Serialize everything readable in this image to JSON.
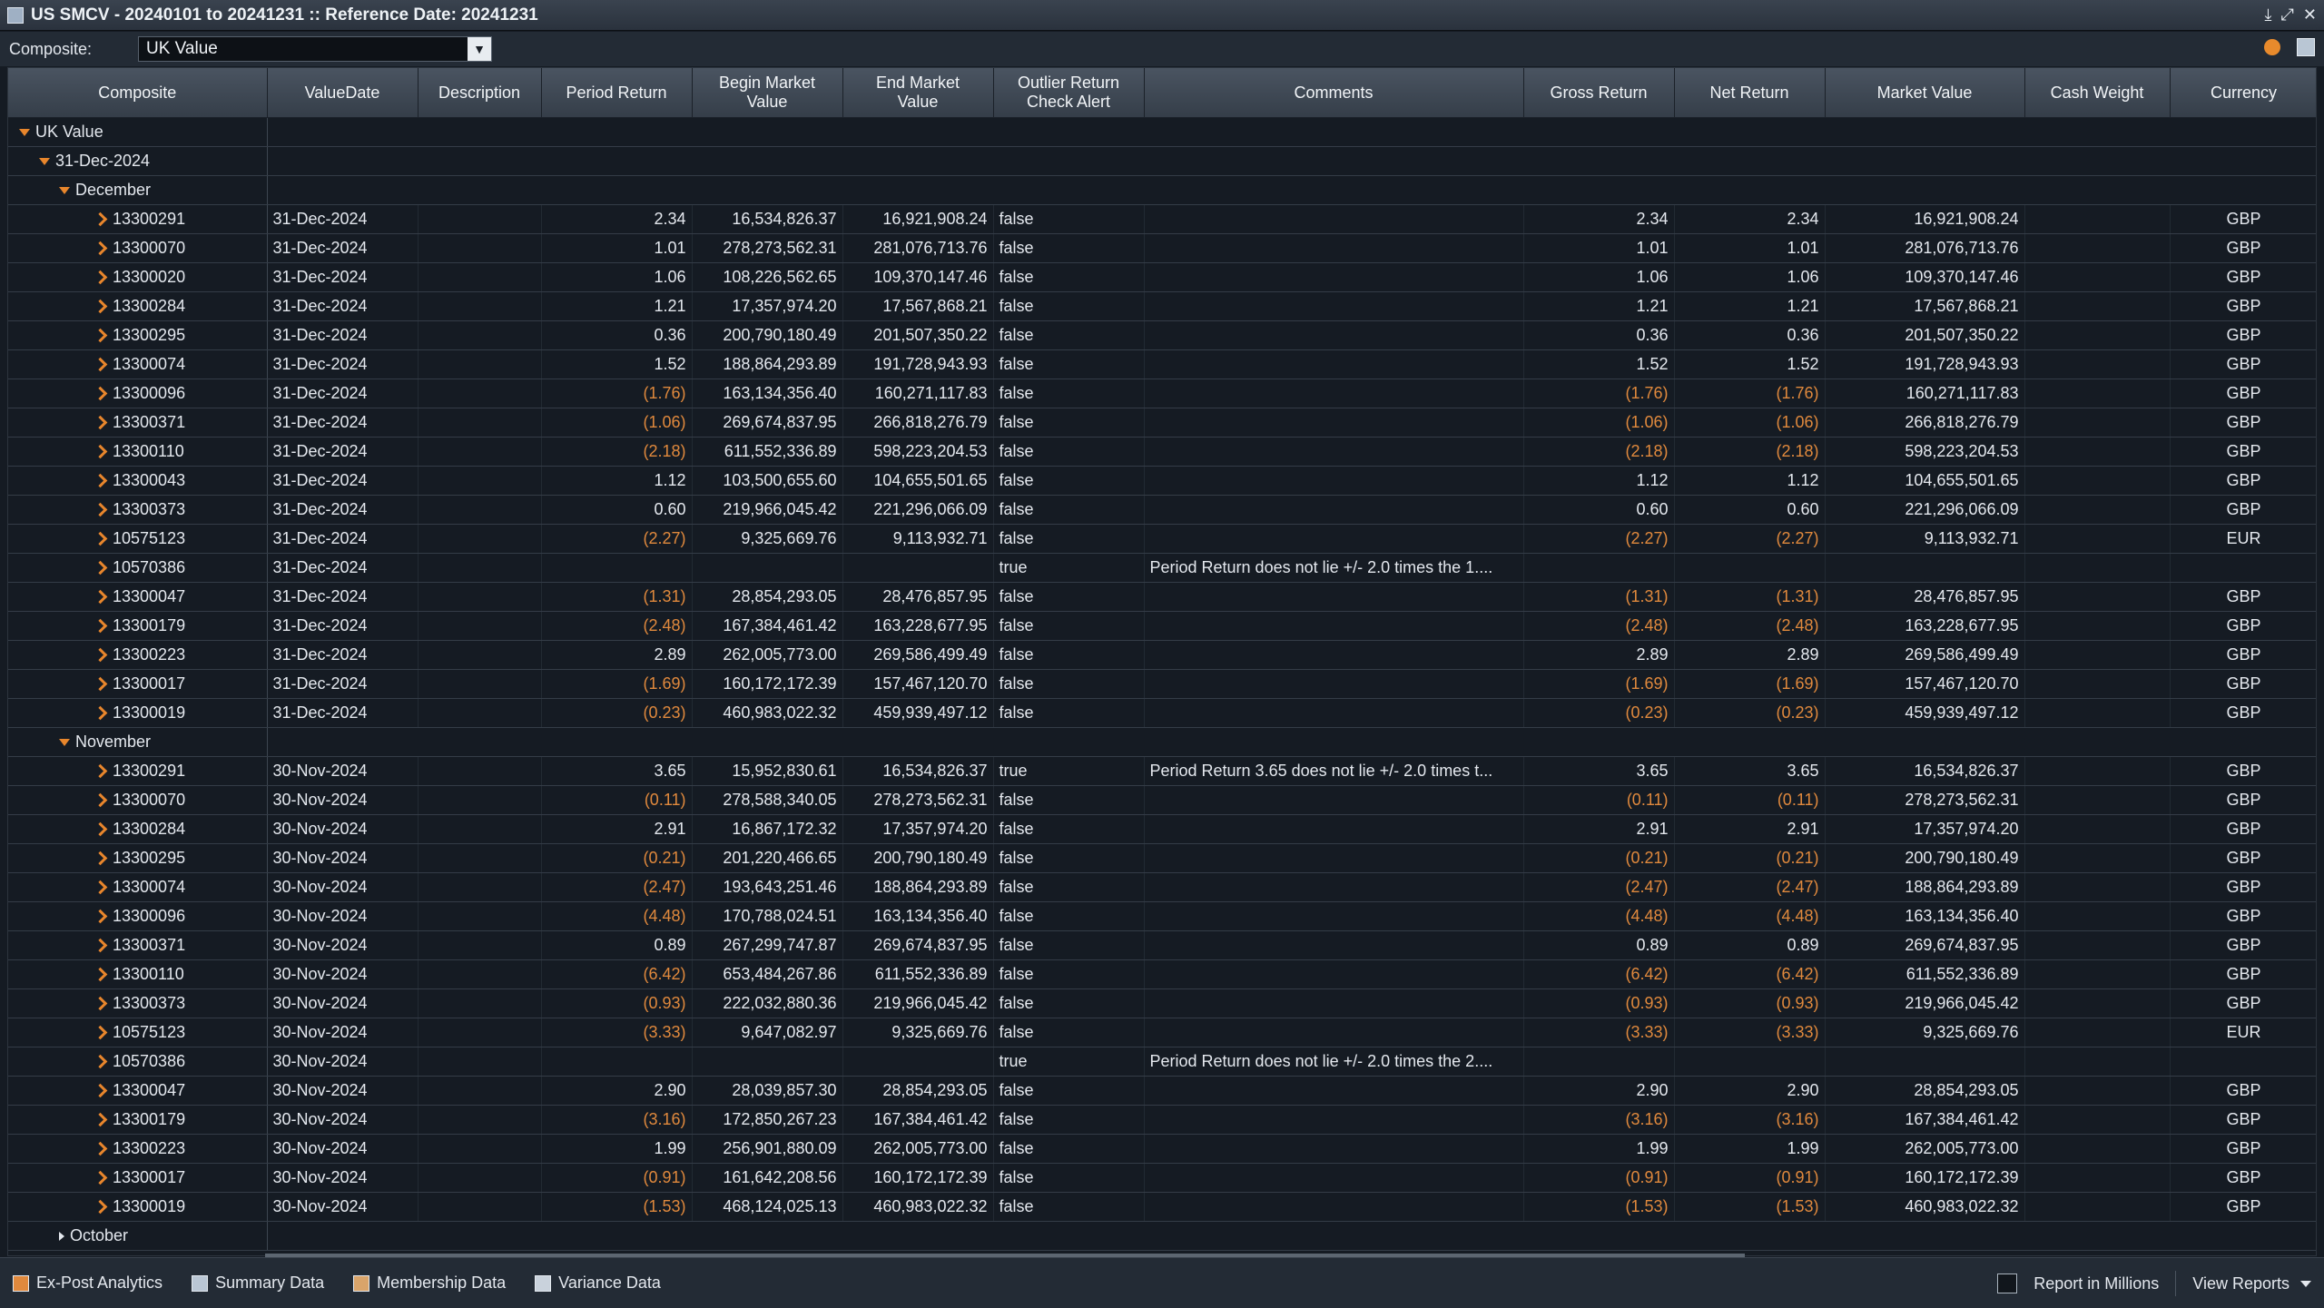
{
  "window": {
    "title": "US SMCV - 20240101 to 20241231 :: Reference Date: 20241231"
  },
  "toolbar": {
    "composite_label": "Composite:",
    "composite_value": "UK Value"
  },
  "columns": [
    "Composite",
    "ValueDate",
    "Description",
    "Period Return",
    "Begin Market\nValue",
    "End Market\nValue",
    "Outlier Return\nCheck Alert",
    "Comments",
    "Gross Return",
    "Net Return",
    "Market Value",
    "Cash Weight",
    "Currency"
  ],
  "tree": {
    "root": "UK Value",
    "date": "31-Dec-2024",
    "groups": [
      {
        "label": "December",
        "expanded": true,
        "rows": [
          {
            "id": "13300291",
            "date": "31-Dec-2024",
            "pr": "2.34",
            "bmv": "16,534,826.37",
            "emv": "16,921,908.24",
            "alert": "false",
            "comment": "",
            "gr": "2.34",
            "nr": "2.34",
            "mv": "16,921,908.24",
            "cur": "GBP"
          },
          {
            "id": "13300070",
            "date": "31-Dec-2024",
            "pr": "1.01",
            "bmv": "278,273,562.31",
            "emv": "281,076,713.76",
            "alert": "false",
            "comment": "",
            "gr": "1.01",
            "nr": "1.01",
            "mv": "281,076,713.76",
            "cur": "GBP"
          },
          {
            "id": "13300020",
            "date": "31-Dec-2024",
            "pr": "1.06",
            "bmv": "108,226,562.65",
            "emv": "109,370,147.46",
            "alert": "false",
            "comment": "",
            "gr": "1.06",
            "nr": "1.06",
            "mv": "109,370,147.46",
            "cur": "GBP"
          },
          {
            "id": "13300284",
            "date": "31-Dec-2024",
            "pr": "1.21",
            "bmv": "17,357,974.20",
            "emv": "17,567,868.21",
            "alert": "false",
            "comment": "",
            "gr": "1.21",
            "nr": "1.21",
            "mv": "17,567,868.21",
            "cur": "GBP"
          },
          {
            "id": "13300295",
            "date": "31-Dec-2024",
            "pr": "0.36",
            "bmv": "200,790,180.49",
            "emv": "201,507,350.22",
            "alert": "false",
            "comment": "",
            "gr": "0.36",
            "nr": "0.36",
            "mv": "201,507,350.22",
            "cur": "GBP"
          },
          {
            "id": "13300074",
            "date": "31-Dec-2024",
            "pr": "1.52",
            "bmv": "188,864,293.89",
            "emv": "191,728,943.93",
            "alert": "false",
            "comment": "",
            "gr": "1.52",
            "nr": "1.52",
            "mv": "191,728,943.93",
            "cur": "GBP"
          },
          {
            "id": "13300096",
            "date": "31-Dec-2024",
            "pr": "(1.76)",
            "bmv": "163,134,356.40",
            "emv": "160,271,117.83",
            "alert": "false",
            "comment": "",
            "gr": "(1.76)",
            "nr": "(1.76)",
            "mv": "160,271,117.83",
            "cur": "GBP"
          },
          {
            "id": "13300371",
            "date": "31-Dec-2024",
            "pr": "(1.06)",
            "bmv": "269,674,837.95",
            "emv": "266,818,276.79",
            "alert": "false",
            "comment": "",
            "gr": "(1.06)",
            "nr": "(1.06)",
            "mv": "266,818,276.79",
            "cur": "GBP"
          },
          {
            "id": "13300110",
            "date": "31-Dec-2024",
            "pr": "(2.18)",
            "bmv": "611,552,336.89",
            "emv": "598,223,204.53",
            "alert": "false",
            "comment": "",
            "gr": "(2.18)",
            "nr": "(2.18)",
            "mv": "598,223,204.53",
            "cur": "GBP"
          },
          {
            "id": "13300043",
            "date": "31-Dec-2024",
            "pr": "1.12",
            "bmv": "103,500,655.60",
            "emv": "104,655,501.65",
            "alert": "false",
            "comment": "",
            "gr": "1.12",
            "nr": "1.12",
            "mv": "104,655,501.65",
            "cur": "GBP"
          },
          {
            "id": "13300373",
            "date": "31-Dec-2024",
            "pr": "0.60",
            "bmv": "219,966,045.42",
            "emv": "221,296,066.09",
            "alert": "false",
            "comment": "",
            "gr": "0.60",
            "nr": "0.60",
            "mv": "221,296,066.09",
            "cur": "GBP"
          },
          {
            "id": "10575123",
            "date": "31-Dec-2024",
            "pr": "(2.27)",
            "bmv": "9,325,669.76",
            "emv": "9,113,932.71",
            "alert": "false",
            "comment": "",
            "gr": "(2.27)",
            "nr": "(2.27)",
            "mv": "9,113,932.71",
            "cur": "EUR"
          },
          {
            "id": "10570386",
            "date": "31-Dec-2024",
            "pr": "",
            "bmv": "",
            "emv": "",
            "alert": "true",
            "comment": "Period Return does not lie +/- 2.0 times the 1....",
            "gr": "",
            "nr": "",
            "mv": "",
            "cur": ""
          },
          {
            "id": "13300047",
            "date": "31-Dec-2024",
            "pr": "(1.31)",
            "bmv": "28,854,293.05",
            "emv": "28,476,857.95",
            "alert": "false",
            "comment": "",
            "gr": "(1.31)",
            "nr": "(1.31)",
            "mv": "28,476,857.95",
            "cur": "GBP"
          },
          {
            "id": "13300179",
            "date": "31-Dec-2024",
            "pr": "(2.48)",
            "bmv": "167,384,461.42",
            "emv": "163,228,677.95",
            "alert": "false",
            "comment": "",
            "gr": "(2.48)",
            "nr": "(2.48)",
            "mv": "163,228,677.95",
            "cur": "GBP"
          },
          {
            "id": "13300223",
            "date": "31-Dec-2024",
            "pr": "2.89",
            "bmv": "262,005,773.00",
            "emv": "269,586,499.49",
            "alert": "false",
            "comment": "",
            "gr": "2.89",
            "nr": "2.89",
            "mv": "269,586,499.49",
            "cur": "GBP"
          },
          {
            "id": "13300017",
            "date": "31-Dec-2024",
            "pr": "(1.69)",
            "bmv": "160,172,172.39",
            "emv": "157,467,120.70",
            "alert": "false",
            "comment": "",
            "gr": "(1.69)",
            "nr": "(1.69)",
            "mv": "157,467,120.70",
            "cur": "GBP"
          },
          {
            "id": "13300019",
            "date": "31-Dec-2024",
            "pr": "(0.23)",
            "bmv": "460,983,022.32",
            "emv": "459,939,497.12",
            "alert": "false",
            "comment": "",
            "gr": "(0.23)",
            "nr": "(0.23)",
            "mv": "459,939,497.12",
            "cur": "GBP"
          }
        ]
      },
      {
        "label": "November",
        "expanded": true,
        "rows": [
          {
            "id": "13300291",
            "date": "30-Nov-2024",
            "pr": "3.65",
            "bmv": "15,952,830.61",
            "emv": "16,534,826.37",
            "alert": "true",
            "comment": "Period Return 3.65 does not lie +/- 2.0 times t...",
            "gr": "3.65",
            "nr": "3.65",
            "mv": "16,534,826.37",
            "cur": "GBP"
          },
          {
            "id": "13300070",
            "date": "30-Nov-2024",
            "pr": "(0.11)",
            "bmv": "278,588,340.05",
            "emv": "278,273,562.31",
            "alert": "false",
            "comment": "",
            "gr": "(0.11)",
            "nr": "(0.11)",
            "mv": "278,273,562.31",
            "cur": "GBP"
          },
          {
            "id": "13300284",
            "date": "30-Nov-2024",
            "pr": "2.91",
            "bmv": "16,867,172.32",
            "emv": "17,357,974.20",
            "alert": "false",
            "comment": "",
            "gr": "2.91",
            "nr": "2.91",
            "mv": "17,357,974.20",
            "cur": "GBP"
          },
          {
            "id": "13300295",
            "date": "30-Nov-2024",
            "pr": "(0.21)",
            "bmv": "201,220,466.65",
            "emv": "200,790,180.49",
            "alert": "false",
            "comment": "",
            "gr": "(0.21)",
            "nr": "(0.21)",
            "mv": "200,790,180.49",
            "cur": "GBP"
          },
          {
            "id": "13300074",
            "date": "30-Nov-2024",
            "pr": "(2.47)",
            "bmv": "193,643,251.46",
            "emv": "188,864,293.89",
            "alert": "false",
            "comment": "",
            "gr": "(2.47)",
            "nr": "(2.47)",
            "mv": "188,864,293.89",
            "cur": "GBP"
          },
          {
            "id": "13300096",
            "date": "30-Nov-2024",
            "pr": "(4.48)",
            "bmv": "170,788,024.51",
            "emv": "163,134,356.40",
            "alert": "false",
            "comment": "",
            "gr": "(4.48)",
            "nr": "(4.48)",
            "mv": "163,134,356.40",
            "cur": "GBP"
          },
          {
            "id": "13300371",
            "date": "30-Nov-2024",
            "pr": "0.89",
            "bmv": "267,299,747.87",
            "emv": "269,674,837.95",
            "alert": "false",
            "comment": "",
            "gr": "0.89",
            "nr": "0.89",
            "mv": "269,674,837.95",
            "cur": "GBP"
          },
          {
            "id": "13300110",
            "date": "30-Nov-2024",
            "pr": "(6.42)",
            "bmv": "653,484,267.86",
            "emv": "611,552,336.89",
            "alert": "false",
            "comment": "",
            "gr": "(6.42)",
            "nr": "(6.42)",
            "mv": "611,552,336.89",
            "cur": "GBP"
          },
          {
            "id": "13300373",
            "date": "30-Nov-2024",
            "pr": "(0.93)",
            "bmv": "222,032,880.36",
            "emv": "219,966,045.42",
            "alert": "false",
            "comment": "",
            "gr": "(0.93)",
            "nr": "(0.93)",
            "mv": "219,966,045.42",
            "cur": "GBP"
          },
          {
            "id": "10575123",
            "date": "30-Nov-2024",
            "pr": "(3.33)",
            "bmv": "9,647,082.97",
            "emv": "9,325,669.76",
            "alert": "false",
            "comment": "",
            "gr": "(3.33)",
            "nr": "(3.33)",
            "mv": "9,325,669.76",
            "cur": "EUR"
          },
          {
            "id": "10570386",
            "date": "30-Nov-2024",
            "pr": "",
            "bmv": "",
            "emv": "",
            "alert": "true",
            "comment": "Period Return does not lie +/- 2.0 times the 2....",
            "gr": "",
            "nr": "",
            "mv": "",
            "cur": ""
          },
          {
            "id": "13300047",
            "date": "30-Nov-2024",
            "pr": "2.90",
            "bmv": "28,039,857.30",
            "emv": "28,854,293.05",
            "alert": "false",
            "comment": "",
            "gr": "2.90",
            "nr": "2.90",
            "mv": "28,854,293.05",
            "cur": "GBP"
          },
          {
            "id": "13300179",
            "date": "30-Nov-2024",
            "pr": "(3.16)",
            "bmv": "172,850,267.23",
            "emv": "167,384,461.42",
            "alert": "false",
            "comment": "",
            "gr": "(3.16)",
            "nr": "(3.16)",
            "mv": "167,384,461.42",
            "cur": "GBP"
          },
          {
            "id": "13300223",
            "date": "30-Nov-2024",
            "pr": "1.99",
            "bmv": "256,901,880.09",
            "emv": "262,005,773.00",
            "alert": "false",
            "comment": "",
            "gr": "1.99",
            "nr": "1.99",
            "mv": "262,005,773.00",
            "cur": "GBP"
          },
          {
            "id": "13300017",
            "date": "30-Nov-2024",
            "pr": "(0.91)",
            "bmv": "161,642,208.56",
            "emv": "160,172,172.39",
            "alert": "false",
            "comment": "",
            "gr": "(0.91)",
            "nr": "(0.91)",
            "mv": "160,172,172.39",
            "cur": "GBP"
          },
          {
            "id": "13300019",
            "date": "30-Nov-2024",
            "pr": "(1.53)",
            "bmv": "468,124,025.13",
            "emv": "460,983,022.32",
            "alert": "false",
            "comment": "",
            "gr": "(1.53)",
            "nr": "(1.53)",
            "mv": "460,983,022.32",
            "cur": "GBP"
          }
        ]
      },
      {
        "label": "October",
        "expanded": false,
        "rows": []
      }
    ]
  },
  "statusbar": {
    "tabs": [
      {
        "label": "Ex-Post Analytics",
        "icon": "chart-icon"
      },
      {
        "label": "Summary Data",
        "icon": "summary-icon"
      },
      {
        "label": "Membership Data",
        "icon": "membership-icon"
      },
      {
        "label": "Variance Data",
        "icon": "clipboard-icon"
      }
    ],
    "report_in_millions": "Report in Millions",
    "view_reports": "View Reports"
  },
  "colors": {
    "negative": "#e0893d",
    "accent": "#e8862c",
    "background": "#151b23"
  }
}
